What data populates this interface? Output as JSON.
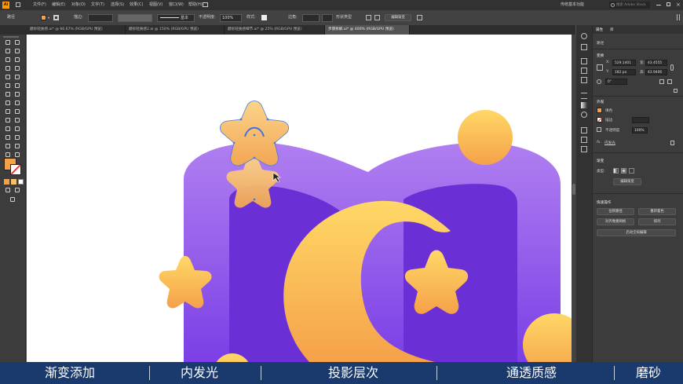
{
  "app": {
    "logo": "Ai",
    "workspace_label": "传统基本功能",
    "search_placeholder": "搜索 Adobe Stock"
  },
  "menu": [
    "文件(F)",
    "编辑(E)",
    "对象(O)",
    "文字(T)",
    "选择(S)",
    "效果(C)",
    "视图(V)",
    "窗口(W)",
    "帮助(H)"
  ],
  "control_bar": {
    "selection_label": "路径",
    "stroke_label": "描边:",
    "stroke_style_label": "基本",
    "opacity_label": "不透明度:",
    "opacity_value": "100%",
    "style_label": "样式:",
    "corner_label": "边角:",
    "shape_label": "形状类型",
    "edit_gradient_button": "编辑渐变"
  },
  "tabs": [
    {
      "label": "磨砂轻质感.ai* @ 66.67% (RGB/GPU 预览)",
      "active": false
    },
    {
      "label": "磨砂轻质感2.ai @ 150% (RGB/GPU 预览)",
      "active": false
    },
    {
      "label": "磨砂轻质感细节.ai* @ 25% (RGB/GPU 预览)",
      "active": false
    },
    {
      "label": "步骤拆解.ai* @ 400% (RGB/GPU 预览)",
      "active": true
    }
  ],
  "panel": {
    "tab_properties": "属性",
    "tab_layers": "库",
    "selection_type": "路径",
    "transform_title": "变换",
    "x_label": "X:",
    "x_value": "529.1401",
    "y_label": "Y:",
    "y_value": "182 px",
    "w_label": "宽:",
    "w_value": "43.4555",
    "h_label": "高:",
    "h_value": "43.9406",
    "angle_value": "0°",
    "appearance_title": "外观",
    "fill_label": "填色",
    "stroke_label": "描边",
    "opacity_label": "不透明度",
    "opacity_value": "100%",
    "fx_label": "内发光",
    "gradient_title": "渐变",
    "gradient_type_label": "类型:",
    "edit_gradient_button": "编辑渐变",
    "quick_actions_title": "快速操作",
    "btn_offset_path": "位移路径",
    "btn_recolor": "重新着色",
    "btn_align_pixel": "对齐像素网格",
    "btn_arrange": "排列",
    "btn_global_edit": "启动全局编辑"
  },
  "colors": {
    "fill": "#f4a24a",
    "stroke": "#e23a3a",
    "book_purple": "#8e4fe8",
    "book_inner": "#6b2fd6",
    "gold_top": "#ffd866",
    "gold_bottom": "#f5a14a",
    "subtitle_bg": "#1a3a6e"
  },
  "subtitle": {
    "items": [
      "渐变添加",
      "内发光",
      "投影层次",
      "通透质感",
      "磨砂"
    ]
  }
}
